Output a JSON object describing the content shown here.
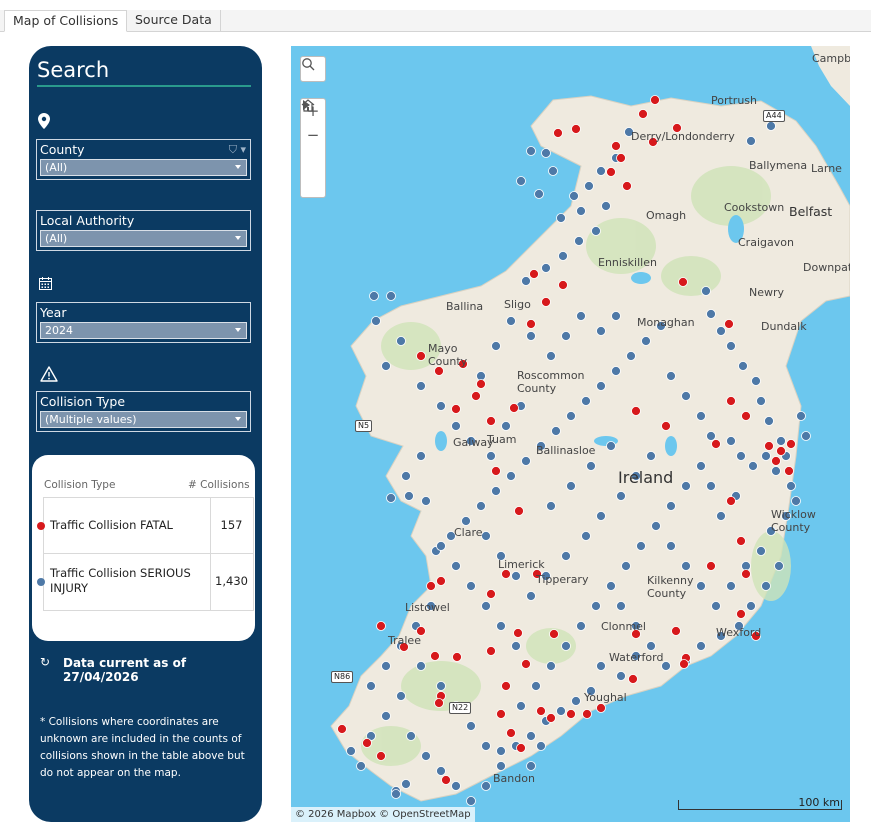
{
  "tabs": [
    {
      "label": "Map of Collisions",
      "active": true
    },
    {
      "label": "Source Data",
      "active": false
    }
  ],
  "search": {
    "title": "Search",
    "filters": {
      "county": {
        "label": "County",
        "value": "(All)"
      },
      "local_authority": {
        "label": "Local Authority",
        "value": "(All)"
      },
      "year": {
        "label": "Year",
        "value": "2024"
      },
      "collision_type": {
        "label": "Collision Type",
        "value": "(Multiple values)"
      }
    },
    "icons": [
      "map-pin-icon",
      "calendar-icon",
      "warning-icon",
      "funnel-icon"
    ]
  },
  "legend_table": {
    "col_type": "Collision Type",
    "col_count": "# Collisions",
    "rows": [
      {
        "name": "Traffic Collision FATAL",
        "count": "157",
        "color": "#d7191c"
      },
      {
        "name": "Traffic Collision SERIOUS INJURY",
        "count": "1,430",
        "color": "#4e79a7"
      }
    ]
  },
  "data_current": "Data current as of 27/04/2026",
  "footnote": "* Collisions where coordinates are unknown  are included in the counts of collisions  shown in the table above but do not appear on the map.",
  "map": {
    "attribution": "© 2026 Mapbox  © OpenStreetMap",
    "scale_label": "100 km",
    "places": [
      {
        "name": "Portrush"
      },
      {
        "name": "Ballymena"
      },
      {
        "name": "Larne"
      },
      {
        "name": "Omagh"
      },
      {
        "name": "Cookstown"
      },
      {
        "name": "Belfast"
      },
      {
        "name": "Craigavon"
      },
      {
        "name": "Enniskillen"
      },
      {
        "name": "Newry"
      },
      {
        "name": "Downpat"
      },
      {
        "name": "Campbe"
      },
      {
        "name": "Ballina"
      },
      {
        "name": "Mayo County"
      },
      {
        "name": "Sligo"
      },
      {
        "name": "Roscommon County"
      },
      {
        "name": "Tuam"
      },
      {
        "name": "Galway"
      },
      {
        "name": "Ballinasloe"
      },
      {
        "name": "Clare"
      },
      {
        "name": "Limerick"
      },
      {
        "name": "Tipperary"
      },
      {
        "name": "Listowel"
      },
      {
        "name": "Tralee"
      },
      {
        "name": "Waterford"
      },
      {
        "name": "Youghal"
      },
      {
        "name": "Wicklow County"
      },
      {
        "name": "Dundalk"
      },
      {
        "name": "Monaghan"
      },
      {
        "name": "Clonmel"
      },
      {
        "name": "Kilkenny County"
      },
      {
        "name": "Wexford"
      },
      {
        "name": "Bandon"
      },
      {
        "name": "Ireland"
      },
      {
        "name": "Derry/Londonderry"
      }
    ],
    "roads": [
      "A44",
      "N5",
      "N86",
      "N22"
    ],
    "controls": [
      "search-icon",
      "zoom-in-icon",
      "zoom-out-icon",
      "home-icon",
      "play-icon"
    ]
  },
  "colors": {
    "panel": "#0b3a62",
    "fatal": "#d7191c",
    "serious": "#4e79a7",
    "sea": "#6cc7ee",
    "land": "#efeadf"
  }
}
